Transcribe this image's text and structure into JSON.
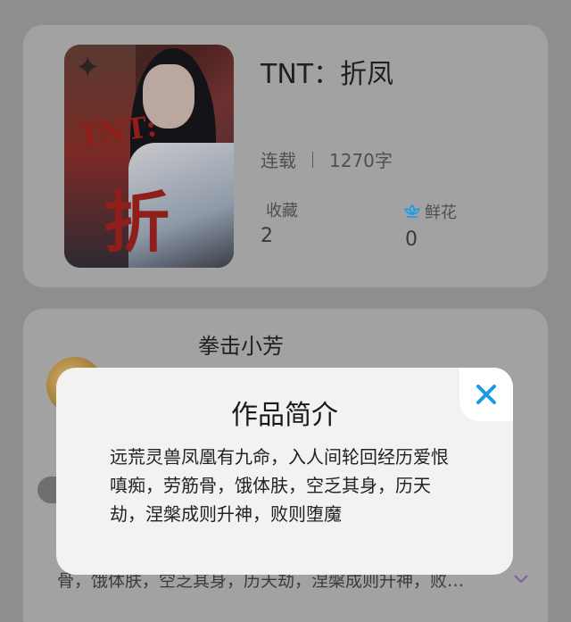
{
  "book": {
    "title": "TNT：折凤",
    "status": "连载",
    "word_count": "1270字",
    "favorites_label": "收藏",
    "favorites_count": "2",
    "flowers_label": "鲜花",
    "flowers_count": "0",
    "cover_art_text": "TNT:",
    "cover_art_char": "折"
  },
  "author": {
    "name": "拳击小芳",
    "intro_preview": "骨，饿体肤，空乏其身，历天劫，涅槃成则升神，败…"
  },
  "modal": {
    "title": "作品简介",
    "body": "远荒灵兽凤凰有九命，入人间轮回经历爱恨嗔痴，劳筋骨，饿体肤，空乏其身，历天劫，涅槃成则升神，败则堕魔"
  },
  "colors": {
    "accent": "#1a9be6",
    "chevron": "#7a5fa0"
  },
  "icons": {
    "close": "close-icon",
    "flower": "flower-icon",
    "expand": "chevron-down-icon"
  }
}
